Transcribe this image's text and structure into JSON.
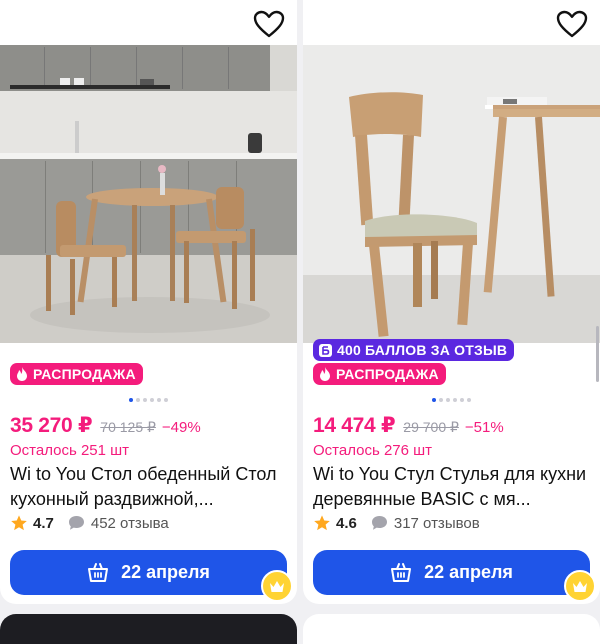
{
  "products": [
    {
      "points_badge": "",
      "sale_badge": "РАСПРОДАЖА",
      "price": "35 270 ₽",
      "old_price": "70 125 ₽",
      "discount": "−49%",
      "stock": "Осталось 251 шт",
      "title": "Wi to You Стол обеденный Стол кухонный раздвижной,...",
      "rating": "4.7",
      "reviews": "452 отзыва",
      "delivery": "22 апреля",
      "image_dots": 6,
      "active_dot": 0
    },
    {
      "points_badge": "400 БАЛЛОВ ЗА ОТЗЫВ",
      "sale_badge": "РАСПРОДАЖА",
      "price": "14 474 ₽",
      "old_price": "29 700 ₽",
      "discount": "−51%",
      "stock": "Осталось 276 шт",
      "title": "Wi to You Стул Стулья для кухни деревянные BASIC с мя...",
      "rating": "4.6",
      "reviews": "317 отзывов",
      "delivery": "22 апреля",
      "image_dots": 6,
      "active_dot": 0
    }
  ],
  "colors": {
    "accent": "#1f55e8",
    "sale": "#f41c7c",
    "points": "#5b28e0",
    "crown": "#ffd333"
  },
  "icons": [
    "heart-icon",
    "fire-icon",
    "points-icon",
    "star-icon",
    "chat-icon",
    "basket-icon",
    "crown-icon"
  ]
}
